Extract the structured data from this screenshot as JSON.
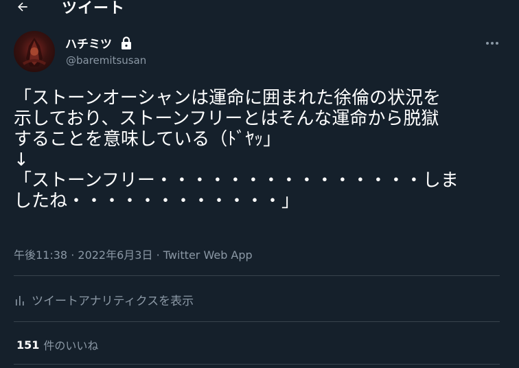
{
  "header": {
    "back_icon": "arrow-left-icon",
    "title": "ツイート"
  },
  "author": {
    "name": "ハチミツ",
    "handle": "@baremitsusan",
    "protected_icon": "lock-icon",
    "avatar_icon": "avatar-image"
  },
  "more_icon": "more-horizontal-icon",
  "tweet": {
    "text": "「ストーンオーシャンは運命に囲まれた徐倫の状況を\n示しており、ストーンフリーとはそんな運命から脱獄\nすることを意味している（ﾄﾞﾔｯ」\n↓\n「ストーンフリー・・・・・・・・・・・・・・・しま\nしたね・・・・・・・・・・・・」"
  },
  "meta": {
    "time": "午後11:38",
    "separator": " · ",
    "date": "2022年6月3日",
    "source": "Twitter Web App"
  },
  "analytics": {
    "icon": "bar-chart-icon",
    "label": "ツイートアナリティクスを表示"
  },
  "likes": {
    "count": "151",
    "label": "件のいいね"
  },
  "colors": {
    "background": "#15202b",
    "text": "#ffffff",
    "secondary_text": "#8b98a5",
    "divider": "#38444d"
  }
}
